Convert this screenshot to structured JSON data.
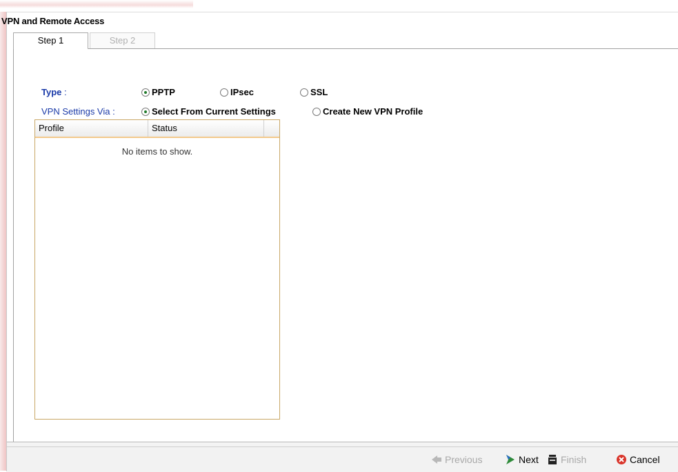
{
  "window": {
    "title": "VPN and Remote Access"
  },
  "tabs": [
    {
      "label": "Step 1",
      "active": true
    },
    {
      "label": "Step 2",
      "active": false
    }
  ],
  "form": {
    "type_label": "Type",
    "type_colon": " :",
    "type_options": [
      "PPTP",
      "IPsec",
      "SSL"
    ],
    "type_selected": "PPTP",
    "via_label": "VPN Settings Via :",
    "via_options": [
      "Select From Current Settings",
      "Create New VPN Profile"
    ],
    "via_selected": "Select From Current Settings"
  },
  "grid": {
    "columns": [
      "Profile",
      "Status"
    ],
    "empty_text": "No items to show."
  },
  "buttons": {
    "previous": "Previous",
    "next": "Next",
    "finish": "Finish",
    "cancel": "Cancel"
  },
  "colors": {
    "label_blue": "#1a3aa8",
    "grid_accent": "#f3c98b",
    "radio_dot": "#1f7a2a"
  },
  "icons": [
    "previous-arrow-icon",
    "next-arrow-icon",
    "finish-icon",
    "cancel-icon"
  ]
}
